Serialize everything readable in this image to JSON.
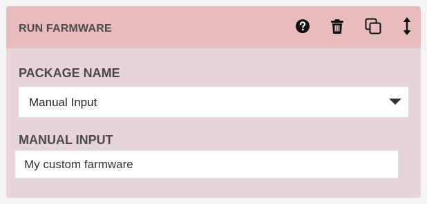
{
  "header": {
    "title": "RUN FARMWARE",
    "icons": [
      "help-icon",
      "trash-icon",
      "duplicate-icon",
      "move-icon"
    ]
  },
  "package": {
    "label": "PACKAGE NAME",
    "selected": "Manual Input"
  },
  "manual": {
    "label": "MANUAL INPUT",
    "value": "My custom farmware"
  },
  "colors": {
    "header_bg": "#e8bcbc",
    "card_bg": "#e7d3db",
    "text": "#4a4a4a"
  }
}
